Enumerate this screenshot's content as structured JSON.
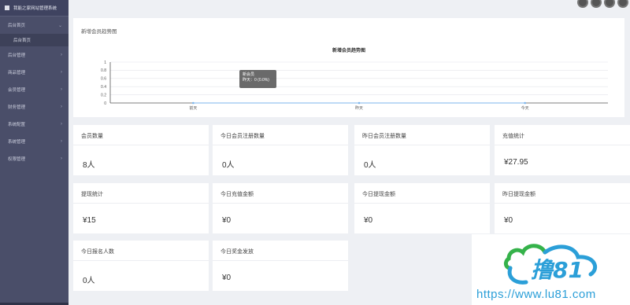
{
  "app": {
    "title": "我能之家网站管理系统"
  },
  "sidebar": {
    "items": [
      {
        "label": "后台首页"
      },
      {
        "label": "后台首页",
        "sub": true
      },
      {
        "label": "后台管理"
      },
      {
        "label": "商品管理"
      },
      {
        "label": "会员管理"
      },
      {
        "label": "财务管理"
      },
      {
        "label": "系统配置"
      },
      {
        "label": "系统管理"
      },
      {
        "label": "权限管理"
      }
    ]
  },
  "chart_panel": {
    "title": "新增会员趋势图"
  },
  "chart_data": {
    "type": "line",
    "title": "新增会员趋势图",
    "categories": [
      "前天",
      "昨天",
      "今天"
    ],
    "series": [
      {
        "name": "新会员",
        "values": [
          0,
          0,
          0
        ]
      }
    ],
    "ylim": [
      0,
      1
    ],
    "yticks": [
      "0",
      "0.2",
      "0.4",
      "0.6",
      "0.8",
      "1"
    ],
    "grid": true,
    "tooltip": {
      "title": "新会员",
      "text": "昨天：0 (0.0%)"
    }
  },
  "cards": [
    {
      "label": "会员数量",
      "value": "8人"
    },
    {
      "label": "今日会员注册数量",
      "value": "0人"
    },
    {
      "label": "昨日会员注册数量",
      "value": "0人"
    },
    {
      "label": "充值统计",
      "value": "¥27.95"
    },
    {
      "label": "提现统计",
      "value": "¥15"
    },
    {
      "label": "今日充值金额",
      "value": "¥0"
    },
    {
      "label": "今日提现金额",
      "value": "¥0"
    },
    {
      "label": "昨日提现金额",
      "value": "¥0"
    },
    {
      "label": "今日报名人数",
      "value": "0人"
    },
    {
      "label": "今日奖金发放",
      "value": "¥0"
    }
  ],
  "watermark": {
    "logo_text": "撸81",
    "url": "https://www.lu81.com"
  },
  "colors": {
    "sidebar": "#4a4e69",
    "accent": "#2b9fd8",
    "background": "#eef0f4"
  }
}
